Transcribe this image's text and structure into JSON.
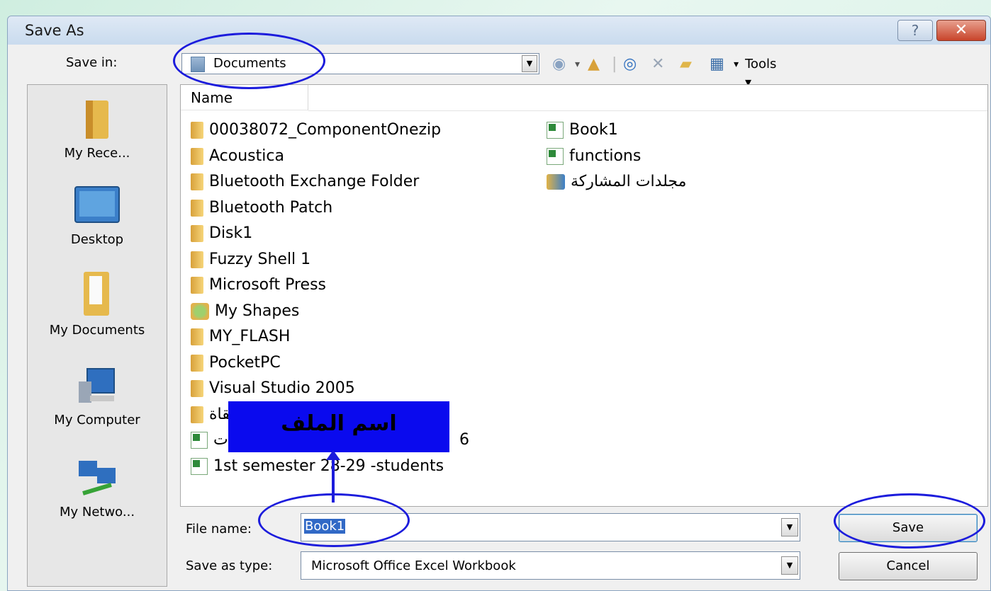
{
  "dialog": {
    "title": "Save As",
    "help_symbol": "?",
    "close_symbol": "✕"
  },
  "save_in": {
    "label": "Save in:",
    "value": "Documents",
    "dropdown_symbol": "▼"
  },
  "toolbar": {
    "back_icon": "back-arrow-icon",
    "up_icon": "up-one-level-icon",
    "search_icon": "search-web-icon",
    "delete_icon": "delete-icon",
    "new_folder_icon": "new-folder-icon",
    "views_icon": "views-icon",
    "tools_label": "Tools"
  },
  "places": [
    {
      "label": "My Rece...",
      "icon": "recent-folder-icon"
    },
    {
      "label": "Desktop",
      "icon": "desktop-icon"
    },
    {
      "label": "My Documents",
      "icon": "documents-folder-icon"
    },
    {
      "label": "My Computer",
      "icon": "computer-icon"
    },
    {
      "label": "My Netwo...",
      "icon": "network-icon"
    }
  ],
  "file_list": {
    "column_name": "Name",
    "column1": [
      {
        "name": "00038072_ComponentOnezip",
        "type": "folder"
      },
      {
        "name": "Acoustica",
        "type": "folder"
      },
      {
        "name": "Bluetooth Exchange Folder",
        "type": "folder"
      },
      {
        "name": "Bluetooth Patch",
        "type": "folder"
      },
      {
        "name": "Disk1",
        "type": "folder"
      },
      {
        "name": "Fuzzy Shell 1",
        "type": "folder"
      },
      {
        "name": "Microsoft Press",
        "type": "folder"
      },
      {
        "name": "My Shapes",
        "type": "special-folder"
      },
      {
        "name": "MY_FLASH",
        "type": "folder"
      },
      {
        "name": "PocketPC",
        "type": "folder"
      },
      {
        "name": "Visual Studio 2005",
        "type": "folder"
      },
      {
        "name": "لقاة",
        "type": "folder"
      },
      {
        "name": "ذات",
        "type": "excel",
        "suffix": "6"
      },
      {
        "name": "1st semester 28-29 -students",
        "type": "excel"
      }
    ],
    "column2": [
      {
        "name": "Book1",
        "type": "excel"
      },
      {
        "name": "functions",
        "type": "excel"
      },
      {
        "name": "مجلدات المشاركة",
        "type": "shared-folder"
      }
    ]
  },
  "file_name": {
    "label": "File name:",
    "value": "Book1",
    "dropdown_symbol": "▼"
  },
  "save_as_type": {
    "label": "Save as type:",
    "value": "Microsoft Office Excel Workbook",
    "dropdown_symbol": "▼"
  },
  "buttons": {
    "save": "Save",
    "cancel": "Cancel"
  },
  "annotation": {
    "text": "اسم الملف",
    "highlight_color": "#1c1cdc",
    "box_color": "#0a0aee"
  }
}
